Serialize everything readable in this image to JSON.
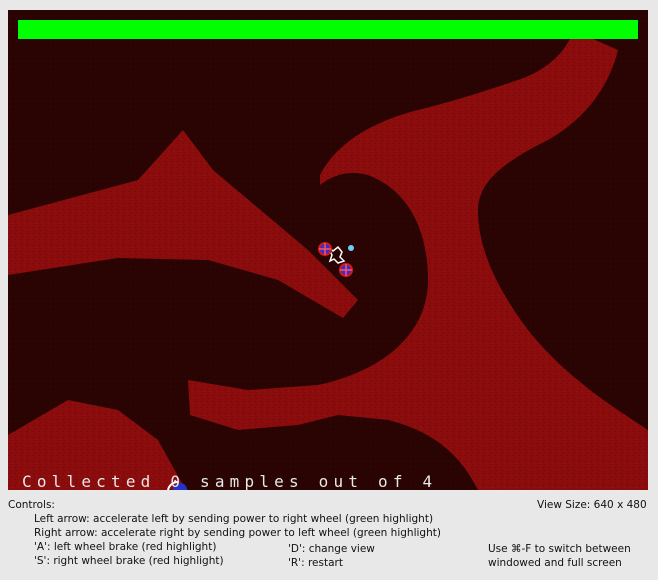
{
  "game": {
    "health_fraction": 1.0,
    "health_color": "#00ff00",
    "status_text": "Collected 0 samples out of 4",
    "samples_collected": 0,
    "samples_total": 4,
    "terrain_color": "#8a0c0c",
    "background_color": "#2a0303"
  },
  "controls": {
    "heading": "Controls:",
    "view_size": "View Size: 640 x 480",
    "left_arrow": "Left arrow: accelerate left by sending power to right wheel (green highlight)",
    "right_arrow": "Right arrow: accelerate right by sending power to left wheel (green highlight)",
    "key_a": "'A': left wheel brake (red highlight)",
    "key_s": "'S': right wheel brake (red highlight)",
    "key_d": "'D': change view",
    "key_r": "'R': restart",
    "fullscreen_line1": "Use ⌘-F to switch between",
    "fullscreen_line2": "windowed and full screen"
  }
}
